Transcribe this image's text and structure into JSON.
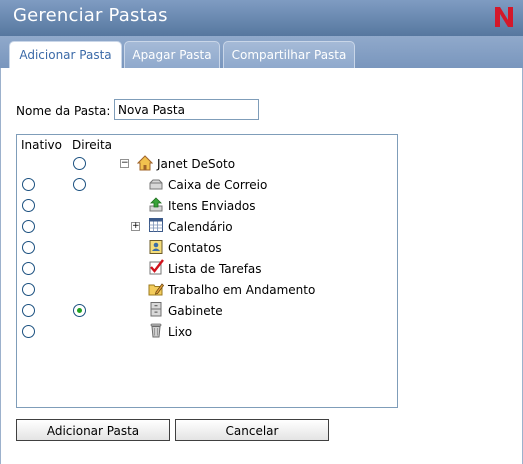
{
  "window": {
    "title": "Gerenciar Pastas"
  },
  "tabs": [
    {
      "label": "Adicionar Pasta",
      "active": true
    },
    {
      "label": "Apagar Pasta",
      "active": false
    },
    {
      "label": "Compartilhar Pasta",
      "active": false
    }
  ],
  "form": {
    "name_label": "Nome da Pasta:",
    "name_value": "Nova Pasta"
  },
  "tree": {
    "headers": {
      "inactive": "Inativo",
      "right": "Direita"
    },
    "items": [
      {
        "label": "Janet DeSoto",
        "icon": "home-icon",
        "inactive_radio": false,
        "right_radio": true,
        "right_checked": false,
        "expander": "minus"
      },
      {
        "label": "Caixa de Correio",
        "icon": "mailbox-icon",
        "inactive_radio": true,
        "right_radio": true,
        "right_checked": false
      },
      {
        "label": "Itens Enviados",
        "icon": "sent-items-icon",
        "inactive_radio": true,
        "right_radio": false
      },
      {
        "label": "Calendário",
        "icon": "calendar-icon",
        "inactive_radio": true,
        "right_radio": false,
        "expander": "plus"
      },
      {
        "label": "Contatos",
        "icon": "contacts-icon",
        "inactive_radio": true,
        "right_radio": false
      },
      {
        "label": "Lista de Tarefas",
        "icon": "task-list-icon",
        "inactive_radio": true,
        "right_radio": false
      },
      {
        "label": "Trabalho em Andamento",
        "icon": "work-in-progress-icon",
        "inactive_radio": true,
        "right_radio": false
      },
      {
        "label": "Gabinete",
        "icon": "cabinet-icon",
        "inactive_radio": true,
        "right_radio": true,
        "right_checked": true
      },
      {
        "label": "Lixo",
        "icon": "trash-icon",
        "inactive_radio": true,
        "right_radio": false
      }
    ]
  },
  "buttons": {
    "add": "Adicionar Pasta",
    "cancel": "Cancelar"
  },
  "colors": {
    "titlebar": "#6a89b3",
    "logo_red": "#d3182a",
    "radio_checked": "#21a121"
  }
}
